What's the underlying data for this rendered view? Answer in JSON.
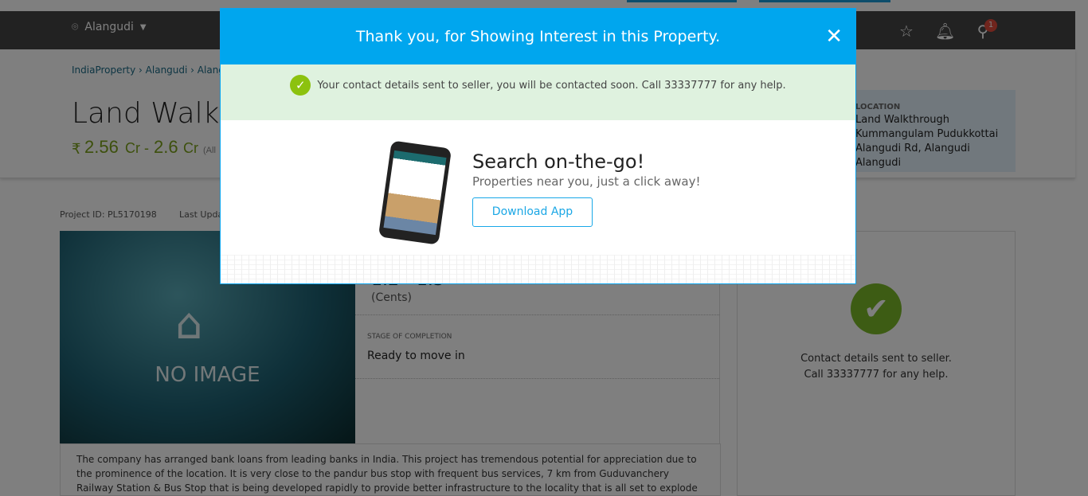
{
  "header": {
    "location": "Alangudi",
    "notification_count": "1"
  },
  "breadcrumb": [
    "IndiaProperty",
    "Alangudi",
    "Alangudi"
  ],
  "property": {
    "title": "Land Walkthrough Kummangulam",
    "price_from": "2.56",
    "price_to": "2.6",
    "unit": "Cr",
    "currency": "₹",
    "price_note": "(All",
    "location_label": "LOCATION",
    "location_value": "Land Walkthrough Kummangulam Pudukkottai Alangudi Rd, Alangudi Alangudi",
    "project_id": "Project ID: PL5170198",
    "last_updated": "Last Updated",
    "no_image": "NO IMAGE",
    "area_value": "1.2 - 1.3",
    "area_unit": "(Cents)",
    "stage_label": "STAGE OF COMPLETION",
    "stage_value": "Ready to move in",
    "description": "The company has arranged bank loans  from leading banks in India. This project has tremendous potential for appreciation due to the prominence of the location. It is very close to the pandur bus stop with frequent bus services, 7 km from Guduvanchery Railway Station & Bus Stop that is being developed rapidly to provide better infrastructure to the locality that is all set to explode"
  },
  "side": {
    "line1": "Contact details sent to seller.",
    "line2": "Call 33337777 for any help."
  },
  "modal": {
    "title": "Thank you, for Showing Interest in this Property.",
    "success": "Your contact details sent to seller, you will be contacted soon. Call 33337777 for any help.",
    "promo_title": "Search on-the-go!",
    "promo_sub": "Properties near you, just a click away!",
    "download": "Download App"
  }
}
